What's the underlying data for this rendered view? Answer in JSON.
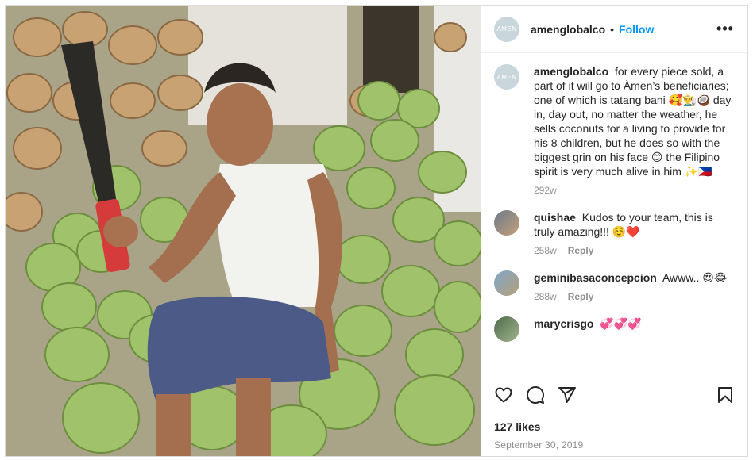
{
  "post": {
    "username": "amenglobalco",
    "avatar_text": "AMEN",
    "follow_label": "Follow",
    "dot": "•",
    "more_label": "•••"
  },
  "caption": {
    "username": "amenglobalco",
    "text": "for every piece sold, a part of it will go to Àmen’s beneficiaries; one of which is tatang bani 🥰👨‍🌾🥥 day in, day out, no matter the weather, he sells coconuts for a living to provide for his 8 children, but he does so with the biggest grin on his face 😊 the Filipino spirit is very much alive in him ✨🇵🇭",
    "time": "292w"
  },
  "comments": [
    {
      "username": "quishae",
      "text": "Kudos to your team, this is truly amazing!!! ☺️❤️",
      "time": "258w",
      "reply": "Reply"
    },
    {
      "username": "geminibasaconcepcion",
      "text": "Awww.. 😍😂",
      "time": "288w",
      "reply": "Reply"
    },
    {
      "username": "marycrisgo",
      "text": "💞💞💞",
      "time": "",
      "reply": ""
    }
  ],
  "footer": {
    "likes": "127 likes",
    "date": "September 30, 2019"
  },
  "icons": [
    "heart-icon",
    "comment-icon",
    "share-icon",
    "bookmark-icon"
  ]
}
